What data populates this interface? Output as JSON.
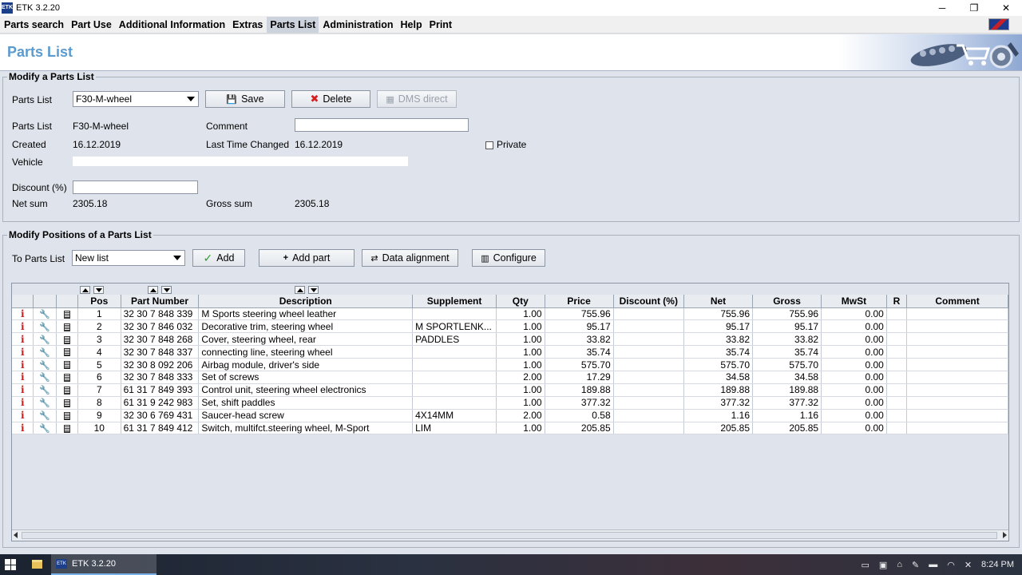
{
  "window": {
    "title": "ETK 3.2.20",
    "minimize": "─",
    "maximize": "❐",
    "close": "✕"
  },
  "menu": [
    "Parts search",
    "Part Use",
    "Additional Information",
    "Extras",
    "Parts List",
    "Administration",
    "Help",
    "Print"
  ],
  "page_title": "Parts List",
  "modify_list": {
    "section_title": "Modify a Parts List",
    "parts_list_label": "Parts List",
    "parts_list_value": "F30-M-wheel",
    "save_label": "Save",
    "delete_label": "Delete",
    "dms_label": "DMS direct",
    "name_label": "Parts List",
    "name_value": "F30-M-wheel",
    "comment_label": "Comment",
    "comment_value": "",
    "created_label": "Created",
    "created_value": "16.12.2019",
    "changed_label": "Last Time Changed",
    "changed_value": "16.12.2019",
    "private_label": "Private",
    "vehicle_label": "Vehicle",
    "vehicle_value": "",
    "discount_label": "Discount (%)",
    "discount_value": "",
    "net_label": "Net sum",
    "net_value": "2305.18",
    "gross_label": "Gross sum",
    "gross_value": "2305.18"
  },
  "positions": {
    "section_title": "Modify Positions of a Parts List",
    "to_list_label": "To Parts List",
    "to_list_value": "New list",
    "add_label": "Add",
    "add_part_label": "Add part",
    "align_label": "Data alignment",
    "configure_label": "Configure"
  },
  "table": {
    "columns": [
      "",
      "",
      "",
      "Pos",
      "Part Number",
      "Description",
      "Supplement",
      "Qty",
      "Price",
      "Discount (%)",
      "Net",
      "Gross",
      "MwSt",
      "R",
      "Comment"
    ],
    "rows": [
      {
        "pos": "1",
        "part": "32 30 7 848 339",
        "desc": "M Sports steering wheel leather",
        "supp": "",
        "qty": "1.00",
        "price": "755.96",
        "disc": "",
        "net": "755.96",
        "gross": "755.96",
        "mwst": "0.00"
      },
      {
        "pos": "2",
        "part": "32 30 7 846 032",
        "desc": "Decorative trim, steering wheel",
        "supp": "M SPORTLENK...",
        "qty": "1.00",
        "price": "95.17",
        "disc": "",
        "net": "95.17",
        "gross": "95.17",
        "mwst": "0.00"
      },
      {
        "pos": "3",
        "part": "32 30 7 848 268",
        "desc": "Cover, steering wheel, rear",
        "supp": "PADDLES",
        "qty": "1.00",
        "price": "33.82",
        "disc": "",
        "net": "33.82",
        "gross": "33.82",
        "mwst": "0.00"
      },
      {
        "pos": "4",
        "part": "32 30 7 848 337",
        "desc": "connecting line, steering wheel",
        "supp": "",
        "qty": "1.00",
        "price": "35.74",
        "disc": "",
        "net": "35.74",
        "gross": "35.74",
        "mwst": "0.00"
      },
      {
        "pos": "5",
        "part": "32 30 8 092 206",
        "desc": "Airbag module, driver's side",
        "supp": "",
        "qty": "1.00",
        "price": "575.70",
        "disc": "",
        "net": "575.70",
        "gross": "575.70",
        "mwst": "0.00"
      },
      {
        "pos": "6",
        "part": "32 30 7 848 333",
        "desc": "Set of screws",
        "supp": "",
        "qty": "2.00",
        "price": "17.29",
        "disc": "",
        "net": "34.58",
        "gross": "34.58",
        "mwst": "0.00"
      },
      {
        "pos": "7",
        "part": "61 31 7 849 393",
        "desc": "Control unit, steering wheel electronics",
        "supp": "",
        "qty": "1.00",
        "price": "189.88",
        "disc": "",
        "net": "189.88",
        "gross": "189.88",
        "mwst": "0.00"
      },
      {
        "pos": "8",
        "part": "61 31 9 242 983",
        "desc": "Set, shift paddles",
        "supp": "",
        "qty": "1.00",
        "price": "377.32",
        "disc": "",
        "net": "377.32",
        "gross": "377.32",
        "mwst": "0.00"
      },
      {
        "pos": "9",
        "part": "32 30 6 769 431",
        "desc": "Saucer-head screw",
        "supp": "4X14MM",
        "qty": "2.00",
        "price": "0.58",
        "disc": "",
        "net": "1.16",
        "gross": "1.16",
        "mwst": "0.00"
      },
      {
        "pos": "10",
        "part": "61 31 7 849 412",
        "desc": "Switch, multifct.steering wheel, M-Sport",
        "supp": "LIM",
        "qty": "1.00",
        "price": "205.85",
        "disc": "",
        "net": "205.85",
        "gross": "205.85",
        "mwst": "0.00"
      }
    ]
  },
  "taskbar": {
    "task_label": "ETK 3.2.20",
    "clock": "8:24 PM"
  },
  "colors": {
    "accent": "#5b9bd0",
    "info_icon": "#cc1f1f",
    "delete_icon": "#d62020",
    "add_icon": "#2a9d2a"
  }
}
